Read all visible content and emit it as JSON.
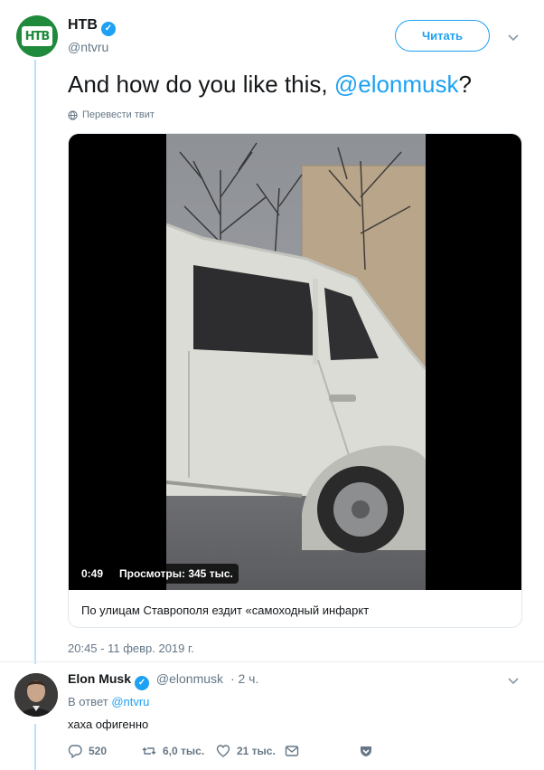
{
  "tweet": {
    "author_name": "НТВ",
    "author_handle": "@ntvru",
    "follow_label": "Читать",
    "text_before": "And how do you like this, ",
    "text_mention": "@elonmusk",
    "text_after": "?",
    "translate_label": "Перевести твит",
    "media": {
      "duration": "0:49",
      "views": "Просмотры: 345 тыс."
    },
    "card_title": "По улицам Ставрополя ездит «самоходный инфаркт",
    "timestamp": "20:45 - 11 февр. 2019 г."
  },
  "reply": {
    "author_name": "Elon Musk",
    "author_handle": "@elonmusk",
    "time": "· 2 ч.",
    "reply_to_prefix": "В ответ ",
    "reply_to_mention": "@ntvru",
    "text": "хаха офигенно",
    "actions": {
      "replies": "520",
      "retweets": "6,0 тыс.",
      "likes": "21 тыс."
    }
  },
  "colors": {
    "accent": "#1da1f2",
    "text": "#14171a",
    "muted": "#657786",
    "thread": "#b8e1f6",
    "brand_ntv": "#1f8a3c"
  },
  "icons": [
    "ntv-logo-icon",
    "verified-icon",
    "chevron-down-icon",
    "globe-icon",
    "reply-icon",
    "retweet-icon",
    "like-icon",
    "message-icon",
    "bookmark-icon"
  ]
}
